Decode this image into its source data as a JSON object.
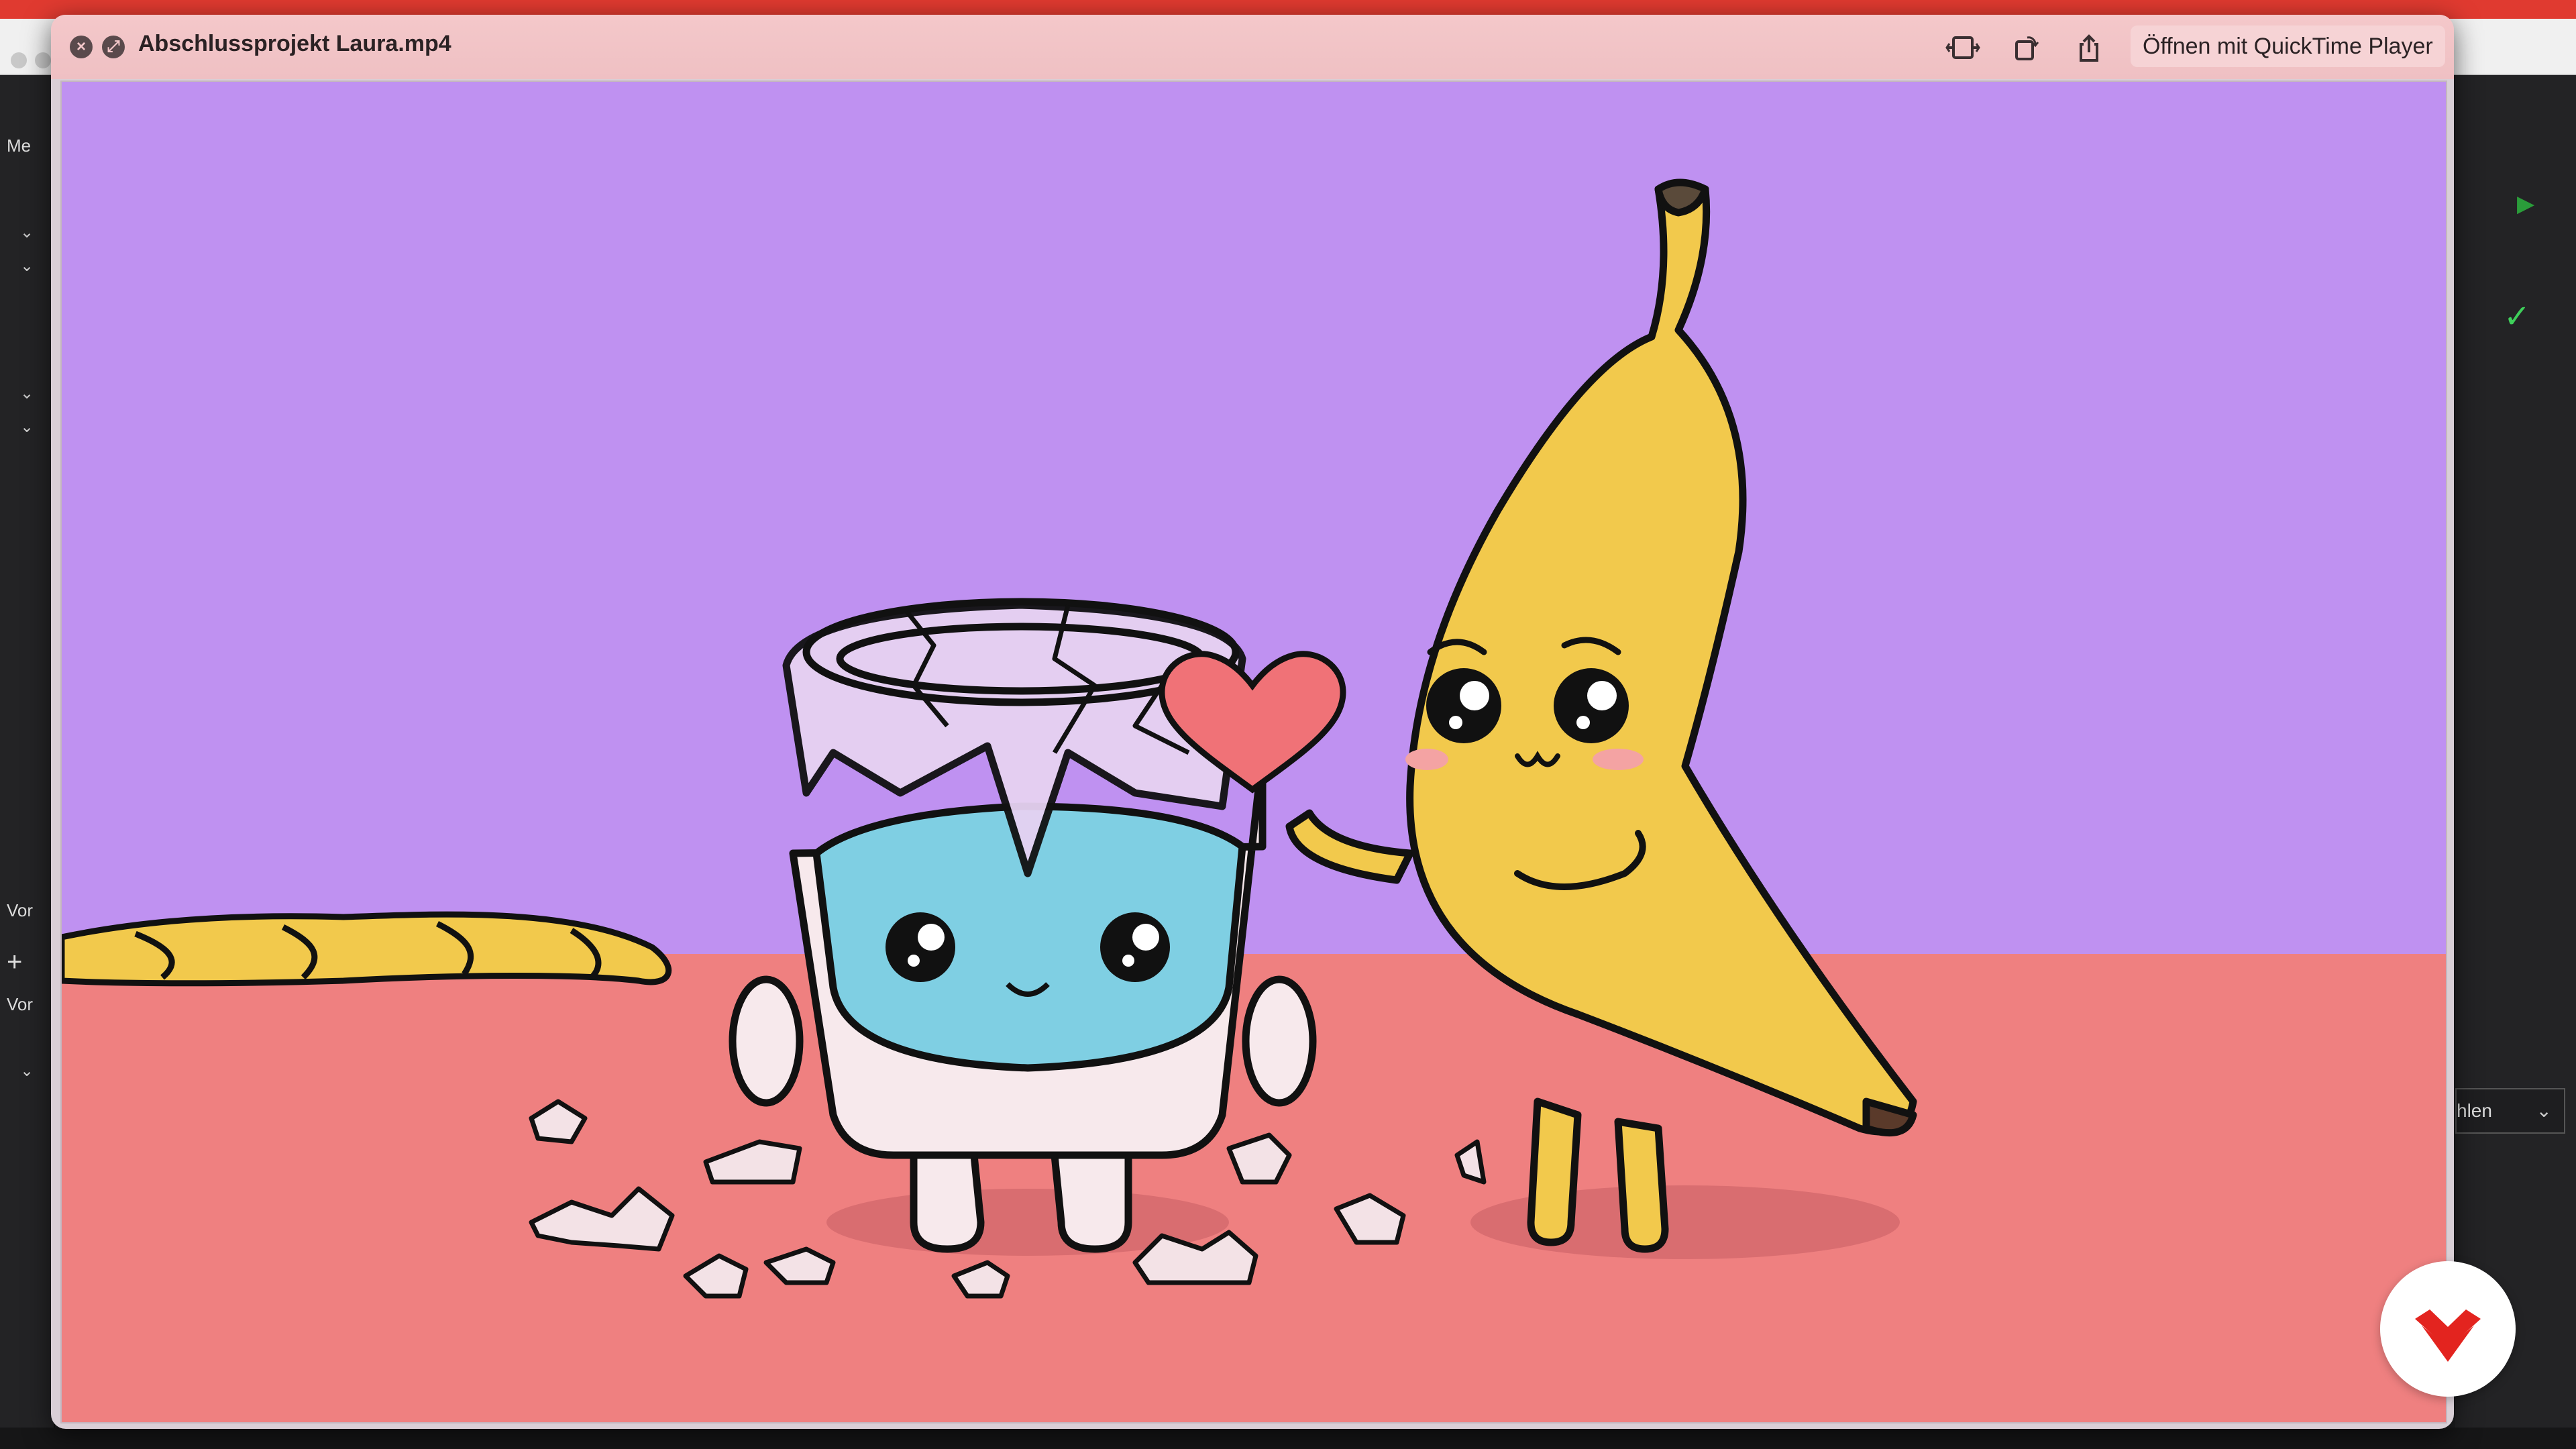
{
  "window": {
    "title": "Abschlussprojekt Laura.mp4",
    "open_with_label": "Öffnen mit QuickTime Player",
    "toolbar_icons": [
      "trim-icon",
      "rotate-icon",
      "share-icon"
    ]
  },
  "background_app": {
    "left_labels": [
      "Me",
      "Vor",
      "Vor"
    ],
    "right_select_label": "hlen"
  },
  "illustration": {
    "sky_color": "#bf91f1",
    "floor_color": "#ef8080",
    "characters": [
      "broken-glass",
      "banana",
      "banana-peel",
      "heart"
    ]
  },
  "colors": {
    "header_tint": "#f4c8ca",
    "accent_red": "#e03a30"
  }
}
